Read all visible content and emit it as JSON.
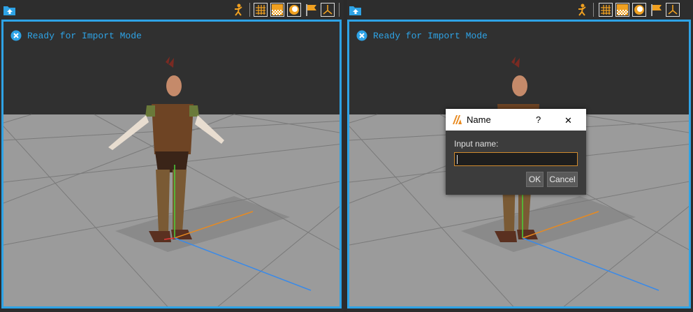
{
  "colors": {
    "accent": "#2ea3e6",
    "sky": "#303030",
    "floor": "#9a9a9a",
    "focus": "#d08a2e"
  },
  "panes": [
    {
      "status": "Ready for Import Mode",
      "toolbar_icons": [
        "import-icon",
        "character-pose-icon",
        "grid-icon",
        "checker-floor-icon",
        "lighting-icon",
        "flag-icon",
        "axis-gizmo-icon"
      ]
    },
    {
      "status": "Ready for Import Mode",
      "toolbar_icons": [
        "import-icon",
        "character-pose-icon",
        "grid-icon",
        "checker-floor-icon",
        "lighting-icon",
        "flag-icon",
        "axis-gizmo-icon"
      ]
    }
  ],
  "dialog": {
    "title": "Name",
    "help": "?",
    "close": "✕",
    "label": "Input name:",
    "value": "",
    "ok": "OK",
    "cancel": "Cancel"
  }
}
